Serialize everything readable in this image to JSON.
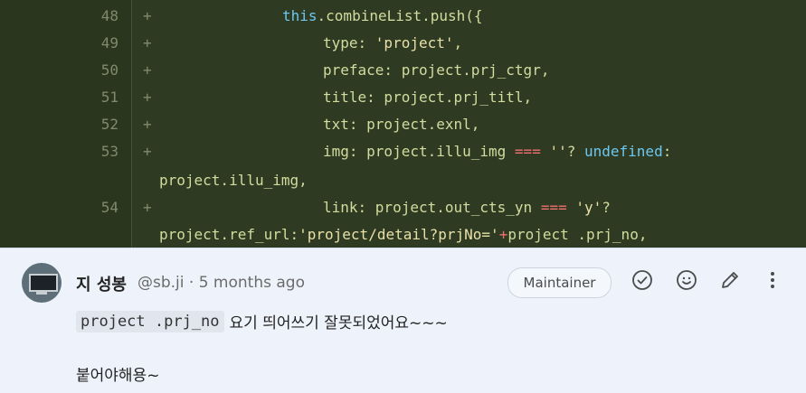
{
  "diff": {
    "lines": [
      {
        "no": "48",
        "marker": "+",
        "parts": [
          [
            "this",
            "kw-this"
          ],
          [
            ".combineList.push({",
            ""
          ]
        ]
      },
      {
        "no": "49",
        "marker": "+",
        "parts": [
          [
            "type: ",
            ""
          ],
          [
            "'project'",
            "str"
          ],
          [
            ",",
            ""
          ]
        ]
      },
      {
        "no": "50",
        "marker": "+",
        "parts": [
          [
            "preface: project.prj_ctgr,",
            ""
          ]
        ]
      },
      {
        "no": "51",
        "marker": "+",
        "parts": [
          [
            "title: project.prj_titl,",
            ""
          ]
        ]
      },
      {
        "no": "52",
        "marker": "+",
        "parts": [
          [
            "txt: project.exnl,",
            ""
          ]
        ]
      },
      {
        "no": "53",
        "marker": "+",
        "parts": [
          [
            "img: project.illu_img ",
            ""
          ],
          [
            "===",
            "op"
          ],
          [
            " ",
            ""
          ],
          [
            "''",
            "str"
          ],
          [
            "? ",
            ""
          ],
          [
            "undefined",
            "kw-undef"
          ],
          [
            ":",
            ""
          ]
        ]
      },
      {
        "no": "",
        "marker": "",
        "parts": [
          [
            "project.illu_img,",
            ""
          ]
        ]
      },
      {
        "no": "54",
        "marker": "+",
        "parts": [
          [
            "link: project.out_cts_yn ",
            ""
          ],
          [
            "===",
            "op"
          ],
          [
            " ",
            ""
          ],
          [
            "'y'",
            "str"
          ],
          [
            "?",
            ""
          ]
        ]
      },
      {
        "no": "",
        "marker": "",
        "parts": [
          [
            "project.ref_url:",
            ""
          ],
          [
            "'project/detail?prjNo='",
            "str"
          ],
          [
            "+",
            "op"
          ],
          [
            "project .prj_no,",
            ""
          ]
        ]
      }
    ]
  },
  "comment": {
    "author": "지 성봉",
    "meta": "@sb.ji · 5 months ago",
    "badge": "Maintainer",
    "inline_code": "project .prj_no",
    "text1": "요기 띄어쓰기 잘못되었어요~~~",
    "text2": "붙어야해용~",
    "icons": [
      "check-circle-icon",
      "smiley-icon",
      "pencil-icon",
      "more-vertical-icon"
    ]
  }
}
